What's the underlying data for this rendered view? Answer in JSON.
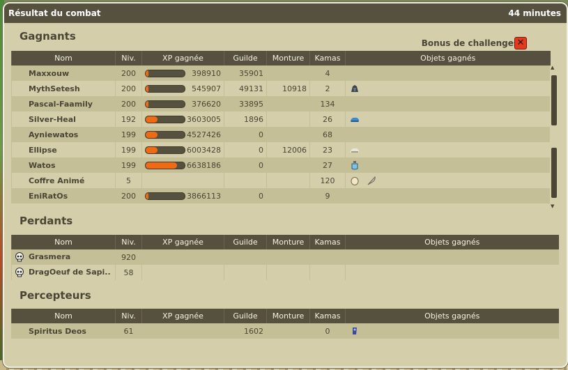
{
  "window": {
    "title": "Résultat du combat",
    "duration": "44 minutes"
  },
  "winners_section": {
    "title": "Gagnants",
    "bonus_label": "Bonus de challenges :",
    "bonus_icon": "challenge-failed-icon"
  },
  "losers_section": {
    "title": "Perdants"
  },
  "collectors_section": {
    "title": "Percepteurs"
  },
  "columns": [
    "Nom",
    "Niv.",
    "XP gagnée",
    "Guilde",
    "Monture",
    "Kamas",
    "Objets gagnés"
  ],
  "winners": [
    {
      "name": "Maxxouw",
      "level": "200",
      "xp": "398910",
      "xp_fill": 0.08,
      "guild": "35901",
      "mount": "",
      "kamas": "4",
      "items": []
    },
    {
      "name": "MythSetesh",
      "level": "200",
      "xp": "545907",
      "xp_fill": 0.08,
      "guild": "49131",
      "mount": "10918",
      "kamas": "2",
      "items": [
        "dark-item-icon"
      ]
    },
    {
      "name": "Pascal-Faamily",
      "level": "200",
      "xp": "376620",
      "xp_fill": 0.08,
      "guild": "33895",
      "mount": "",
      "kamas": "134",
      "items": []
    },
    {
      "name": "Silver-Heal",
      "level": "192",
      "xp": "3603005",
      "xp_fill": 0.3,
      "guild": "1896",
      "mount": "",
      "kamas": "26",
      "items": [
        "blue-boots-icon"
      ]
    },
    {
      "name": "Ayniewatos",
      "level": "199",
      "xp": "4527426",
      "xp_fill": 0.3,
      "guild": "0",
      "mount": "",
      "kamas": "68",
      "items": []
    },
    {
      "name": "Ellipse",
      "level": "199",
      "xp": "6003428",
      "xp_fill": 0.3,
      "guild": "0",
      "mount": "12006",
      "kamas": "23",
      "items": [
        "white-boots-icon"
      ]
    },
    {
      "name": "Watos",
      "level": "199",
      "xp": "6638186",
      "xp_fill": 0.8,
      "guild": "0",
      "mount": "",
      "kamas": "27",
      "items": [
        "potion-icon"
      ]
    },
    {
      "name": "Coffre Animé",
      "level": "5",
      "xp": "",
      "xp_fill": null,
      "guild": "",
      "mount": "",
      "kamas": "120",
      "items": [
        "egg-icon",
        "feather-icon"
      ]
    },
    {
      "name": "EniRatOs",
      "level": "200",
      "xp": "3866113",
      "xp_fill": 0.08,
      "guild": "0",
      "mount": "",
      "kamas": "9",
      "items": []
    }
  ],
  "losers": [
    {
      "name": "Grasmera",
      "level": "920",
      "icon": "skull-icon"
    },
    {
      "name": "DragOeuf de Sapi..",
      "level": "58",
      "icon": "skull-icon"
    }
  ],
  "collectors": [
    {
      "name": "Spiritus Deos",
      "level": "61",
      "guild": "1602",
      "kamas": "0",
      "items": [
        "scroll-icon"
      ]
    }
  ],
  "colors": {
    "header": "#56503f",
    "panel": "#d4cfaa",
    "row_alt": "#c5bf97",
    "xp_fill": "#ef6a12",
    "bonus_fail": "#e23a1c"
  }
}
